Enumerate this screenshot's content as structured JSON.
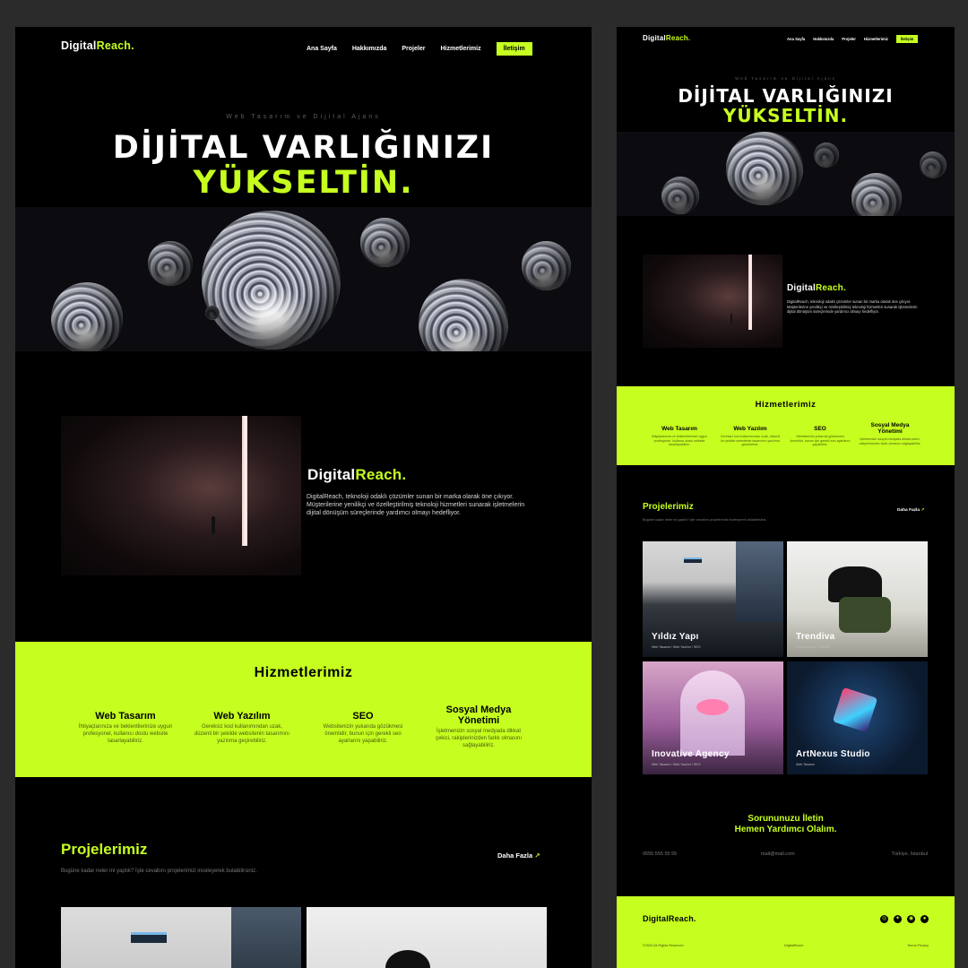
{
  "brand": {
    "first": "Digital",
    "second": "Reach."
  },
  "nav": {
    "home": "Ana Sayfa",
    "about": "Hakkımızda",
    "projects": "Projeler",
    "services": "Hizmetlerimiz",
    "contact": "İletişim"
  },
  "hero": {
    "eyebrow": "Web Tasarım ve Dijital Ajans",
    "line1": "DİJİTAL VARLIĞINIZI",
    "line2": "YÜKSELTİN."
  },
  "about": {
    "text": "DigitalReach, teknoloji odaklı çözümler sunan bir marka olarak öne çıkıyor. Müşterilerine yenilikçi ve özelleştirilmiş teknoloji hizmetleri sunarak işletmelerin dijital dönüşüm süreçlerinde yardımcı olmayı hedefliyor."
  },
  "services": {
    "title": "Hizmetlerimiz",
    "items": [
      {
        "title": "Web Tasarım",
        "desc": "İhtiyaçlarınıza ve beklentilerinize uygun profesyonel, kullanıcı dostu website tasarlayabiliriz."
      },
      {
        "title": "Web Yazılım",
        "desc": "Gereksiz kod kullanımından uzak, düzenli bir şekilde websitenin tasarımını yazılıma geçirebiliriz."
      },
      {
        "title": "SEO",
        "desc": "Websitenizin yukarıda gözükmesi önemlidir, bunun için gerekli seo ayarlarını yapabiliriz."
      },
      {
        "title": "Sosyal Medya Yönetimi",
        "desc": "İşletmenizin sosyal medyada dikkat çekici, rakiplerinizden farklı olmasını sağlayabiliriz."
      }
    ]
  },
  "projects": {
    "title": "Projelerimiz",
    "subtitle": "Bugüne kadar neler mi yaptık? İşte cevabını projelerimizi inceleyerek bulabilirsiniz.",
    "more": "Daha Fazla",
    "more_icon": "arrow-up-right-icon",
    "items": [
      {
        "name": "Yıldız Yapı",
        "tags": "Web Tasarım / Web Yazılım / SEO"
      },
      {
        "name": "Trendiva",
        "tags": "Sosyal Medya Yönetimi"
      },
      {
        "name": "Inovative Agency",
        "tags": "Web Tasarım / Web Yazılım / SEO"
      },
      {
        "name": "ArtNexus Studio",
        "tags": "Web Tasarım"
      }
    ]
  },
  "contact": {
    "line1": "Sorununuzu İletin",
    "line2": "Hemen Yardımcı Olalım.",
    "phone": "0555 555 55 55",
    "email": "mail@mail.com",
    "location": "Türkiye, İstanbul"
  },
  "footer": {
    "copyright": "©2023 All Rights Reserved",
    "center": "DigitalReach",
    "terms": "Terms Privacy",
    "social_icons": [
      "instagram-icon",
      "twitter-icon",
      "discord-icon",
      "facebook-icon"
    ]
  },
  "colors": {
    "accent": "#c6ff1f",
    "background": "#000000",
    "canvas": "#2b2b2b"
  }
}
